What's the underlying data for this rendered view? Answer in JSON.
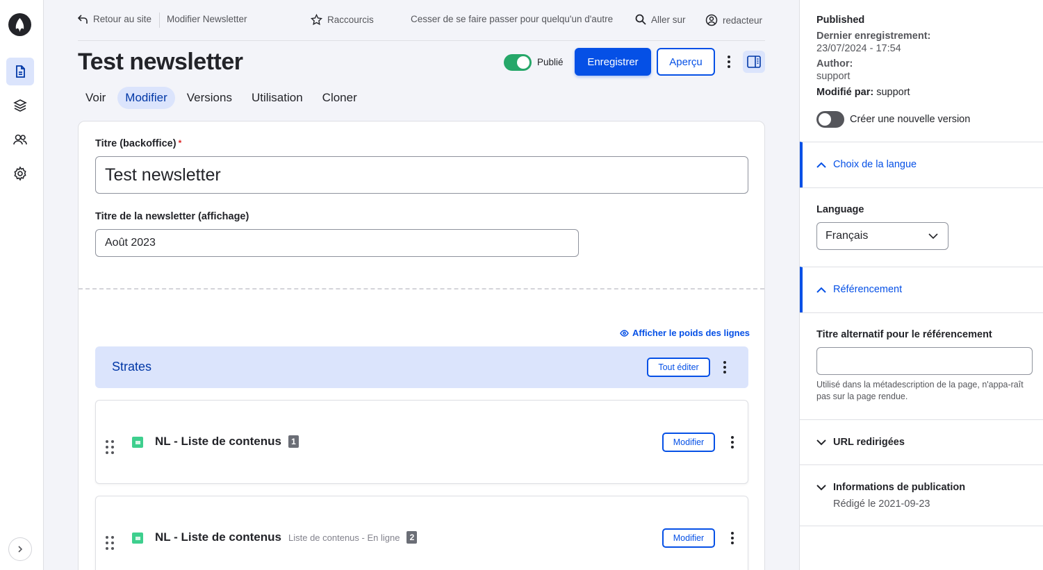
{
  "toolbar": {
    "items": [
      {
        "icon": "file-icon",
        "active": true
      },
      {
        "icon": "layers-icon",
        "active": false
      },
      {
        "icon": "users-icon",
        "active": false
      },
      {
        "icon": "gear-icon",
        "active": false
      }
    ]
  },
  "topbar": {
    "back": "Retour au site",
    "breadcrumb": "Modifier Newsletter",
    "shortcuts": "Raccourcis",
    "impersonate": "Cesser de se faire passer pour quelqu'un d'autre",
    "goto": "Aller sur",
    "user": "redacteur"
  },
  "header": {
    "title": "Test newsletter",
    "published_label": "Publié",
    "published": true,
    "save_label": "Enregistrer",
    "preview_label": "Aperçu"
  },
  "tabs": [
    {
      "label": "Voir",
      "active": false
    },
    {
      "label": "Modifier",
      "active": true
    },
    {
      "label": "Versions",
      "active": false
    },
    {
      "label": "Utilisation",
      "active": false
    },
    {
      "label": "Cloner",
      "active": false
    }
  ],
  "form": {
    "title_label": "Titre (backoffice)",
    "title_required_mark": "*",
    "title_value": "Test newsletter",
    "display_title_label": "Titre de la newsletter (affichage)",
    "display_title_value": "Août 2023",
    "weights_link": "Afficher le poids des lignes",
    "strates_title": "Strates",
    "edit_all_label": "Tout éditer",
    "paragraphs": [
      {
        "title": "NL - Liste de contenus",
        "subtitle": "",
        "badge": "1",
        "edit_label": "Modifier"
      },
      {
        "title": "NL - Liste de contenus",
        "subtitle": "Liste de contenus - En ligne",
        "badge": "2",
        "edit_label": "Modifier"
      }
    ]
  },
  "sidebar": {
    "status": "Published",
    "last_saved_label": "Dernier enregistrement:",
    "last_saved_value": "23/07/2024 - 17:54",
    "author_label": "Author:",
    "author_value": "support",
    "modified_by_label": "Modifié par:",
    "modified_by_value": "support",
    "new_revision_label": "Créer une nouvelle version",
    "new_revision": false,
    "language_section": "Choix de la langue",
    "language_label": "Language",
    "language_value": "Français",
    "seo_section": "Référencement",
    "seo_title_label": "Titre alternatif pour le référencement",
    "seo_title_value": "",
    "seo_help": "Utilisé dans la métadescription de la page, n'appa-raît pas sur la page rendue.",
    "redirects_section": "URL redirigées",
    "publication_section": "Informations de publication",
    "publication_date": "Rédigé le 2021-09-23"
  },
  "colors": {
    "accent": "#0550e6",
    "accent_light": "#dbe4fc",
    "success": "#26a769",
    "paragraph_icon": "#3ecf8e"
  }
}
